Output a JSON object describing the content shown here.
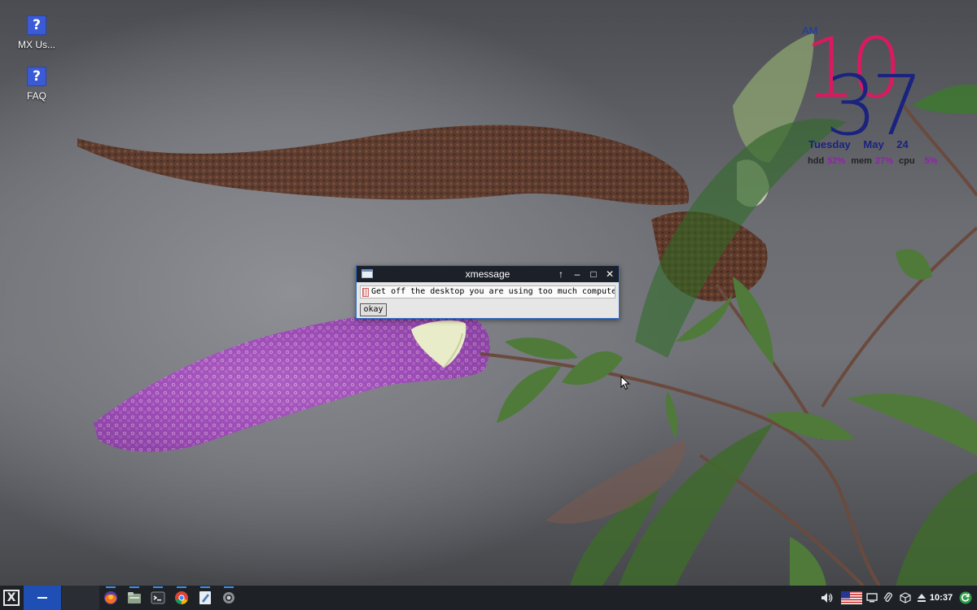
{
  "desktop": {
    "icons": [
      {
        "label": "MX Us...",
        "icon": "help-icon"
      },
      {
        "label": "FAQ",
        "icon": "help-icon"
      }
    ]
  },
  "clock": {
    "hour": "10",
    "minute": "37",
    "ampm": "AM",
    "date": "Tuesday May 24",
    "stats": {
      "hdd_label": "hdd",
      "hdd_value": "52%",
      "mem_label": "mem",
      "mem_value": "27%",
      "cpu_label": "cpu",
      "cpu_value": "5%"
    },
    "colors": {
      "hour": "#d81b60",
      "minute": "#1a237e"
    }
  },
  "xmessage": {
    "title": "xmessage",
    "message": "Get off the desktop you are using too much computer",
    "button_label": "okay",
    "title_buttons": [
      "↑",
      "–",
      "□",
      "✕"
    ]
  },
  "taskbar": {
    "workspace_label": "—",
    "launchers": [
      {
        "name": "firefox-icon",
        "color": "#e8572c"
      },
      {
        "name": "file-manager-icon",
        "color": "#8fa38b"
      },
      {
        "name": "terminal-icon",
        "color": "#30343a"
      },
      {
        "name": "chrome-icon",
        "color": "#db4437"
      },
      {
        "name": "text-editor-icon",
        "color": "#4f7fbf"
      },
      {
        "name": "settings-icon",
        "color": "#8a8f96"
      }
    ],
    "tray": {
      "time": "10:37",
      "icons": [
        "volume-icon",
        "us-flag-icon",
        "screen-icon",
        "clipboard-icon",
        "package-icon",
        "eject-icon",
        "update-icon"
      ]
    },
    "accent": "#1f4fb4"
  }
}
